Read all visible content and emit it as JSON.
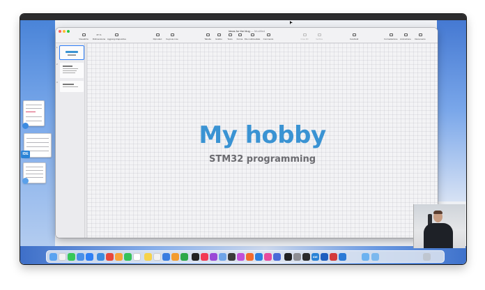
{
  "colors": {
    "accent": "#2d7cf6",
    "slide_title": "#3a93d3",
    "slide_subtitle": "#6b6b70",
    "ide_badge": "#2a83d6"
  },
  "window": {
    "document_title": "Ideas for the blog",
    "title_suffix": "— Modified"
  },
  "toolbar": {
    "items": [
      {
        "label": "Visualizza",
        "icon": "sidebar-icon",
        "enabled": true
      },
      {
        "label": "Ridimensiona",
        "icon": "zoom-icon",
        "enabled": true,
        "value": "87 %"
      },
      {
        "label": "Aggiungi diapositiva",
        "icon": "add-slide-icon",
        "enabled": true
      },
      {
        "label": "Riproduci",
        "icon": "play-icon",
        "enabled": true
      },
      {
        "label": "Keynote Live",
        "icon": "keynote-live-icon",
        "enabled": true
      },
      {
        "label": "Tabella",
        "icon": "table-icon",
        "enabled": true
      },
      {
        "label": "Grafico",
        "icon": "chart-icon",
        "enabled": true
      },
      {
        "label": "Testo",
        "icon": "text-icon",
        "enabled": true
      },
      {
        "label": "Forma",
        "icon": "shape-icon",
        "enabled": true
      },
      {
        "label": "File multimediale",
        "icon": "media-icon",
        "enabled": true
      },
      {
        "label": "Commento",
        "icon": "comment-icon",
        "enabled": true
      },
      {
        "label": "Crea 3D",
        "icon": "magic-move-icon",
        "enabled": false
      },
      {
        "label": "Verifica",
        "icon": "check-icon",
        "enabled": false
      },
      {
        "label": "Condividi",
        "icon": "share-icon",
        "enabled": true
      },
      {
        "label": "Formattazione",
        "icon": "format-icon",
        "enabled": true
      },
      {
        "label": "Animazione",
        "icon": "animate-icon",
        "enabled": true
      },
      {
        "label": "Documento",
        "icon": "document-icon",
        "enabled": true
      }
    ]
  },
  "navigator": {
    "slides": [
      {
        "number": "1",
        "selected": true
      },
      {
        "number": "2",
        "selected": false
      },
      {
        "number": "3",
        "selected": false
      }
    ]
  },
  "slide": {
    "title": "My hobby",
    "subtitle": "STM32 programming"
  },
  "stage_manager": {
    "ide_label": "IDE"
  },
  "dock": {
    "ide_label": "IDE",
    "icons": [
      "finder-icon",
      "dictionary-icon",
      "messages-icon",
      "safari-icon",
      "app-store-icon",
      "mail-icon",
      "chrome-icon",
      "photos-icon",
      "facetime-icon",
      "calendar-icon",
      "notes-icon",
      "reminders-icon",
      "keynote-icon",
      "pages-icon",
      "numbers-icon",
      "tv-icon",
      "music-icon",
      "podcasts-icon",
      "preview-icon",
      "star-icon",
      "affinity-icon",
      "swift-icon",
      "xcode-icon",
      "pen-icon",
      "bbedit-icon",
      "terminal-icon",
      "settings-icon",
      "calculator-icon",
      "ide-icon",
      "stm32-icon",
      "screenflow-icon",
      "vscode-icon",
      "downloads-icon",
      "folder-icon",
      "trash-icon"
    ]
  }
}
